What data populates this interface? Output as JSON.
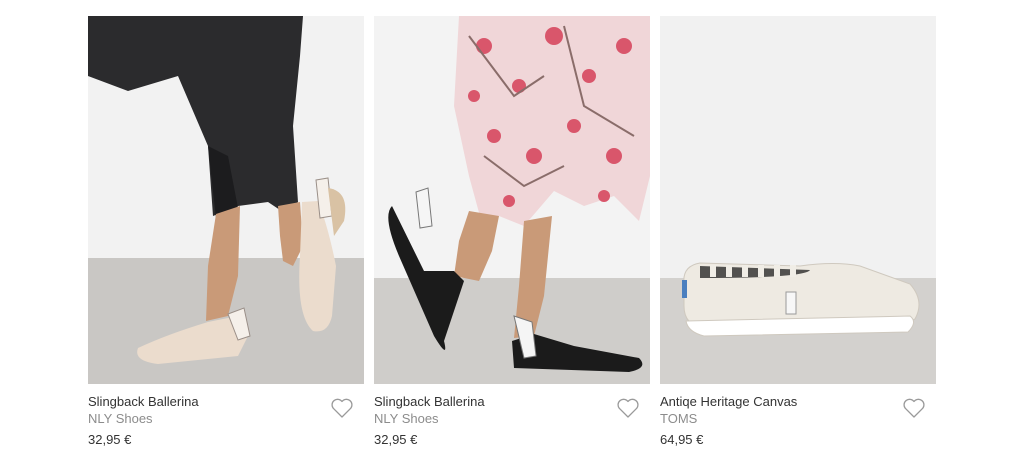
{
  "products": [
    {
      "name": "Slingback Ballerina",
      "brand": "NLY Shoes",
      "price": "32,95 €"
    },
    {
      "name": "Slingback Ballerina",
      "brand": "NLY Shoes",
      "price": "32,95 €"
    },
    {
      "name": "Antiqe Heritage Canvas",
      "brand": "TOMS",
      "price": "64,95 €"
    }
  ],
  "icons": {
    "favorite": "heart-outline-icon"
  },
  "colors": {
    "text": "#333333",
    "brand_text": "#8c8c8c",
    "heart_stroke": "#9a9a9a"
  }
}
